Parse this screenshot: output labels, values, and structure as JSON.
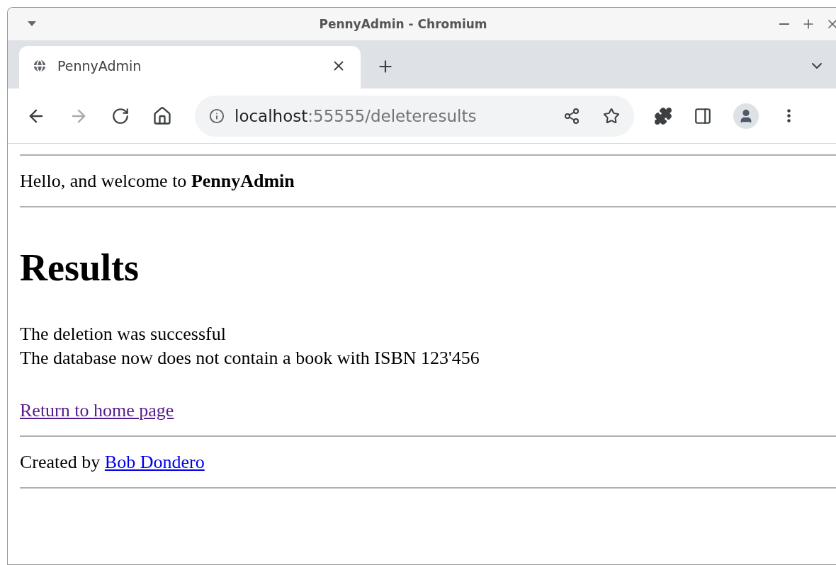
{
  "window": {
    "title": "PennyAdmin - Chromium"
  },
  "tabs": [
    {
      "label": "PennyAdmin",
      "selected": true
    }
  ],
  "address_bar": {
    "host": "localhost",
    "path": ":55555/deleteresults"
  },
  "page": {
    "welcome": "Hello, and welcome to **PennyAdmin**",
    "heading": "Results",
    "message_lines": [
      "The deletion was successful",
      "The database now does not contain a book with ISBN 123'456"
    ],
    "return_link": {
      "label": "Return to home page",
      "visited": true
    },
    "footer": {
      "text": "Created by",
      "link": {
        "label": "Bob Dondero",
        "visited": false
      }
    }
  }
}
